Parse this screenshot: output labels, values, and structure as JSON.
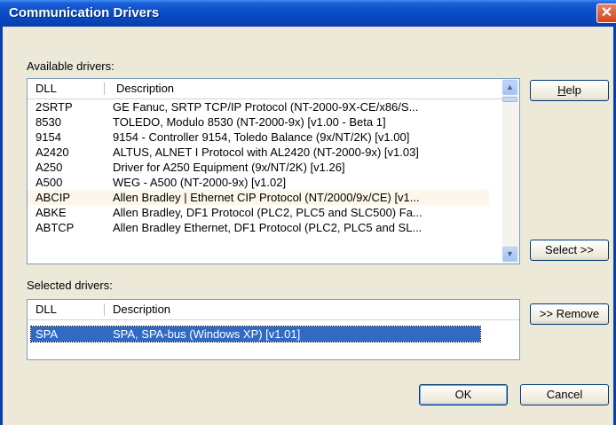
{
  "window": {
    "title": "Communication Drivers",
    "close_glyph": "✕"
  },
  "available": {
    "label": "Available drivers:",
    "col_dll": "DLL",
    "col_description": "Description",
    "rows": [
      {
        "dll": "2SRTP",
        "description": "GE Fanuc, SRTP TCP/IP Protocol (NT-2000-9X-CE/x86/S..."
      },
      {
        "dll": "8530",
        "description": "TOLEDO, Modulo 8530 (NT-2000-9x) [v1.00 - Beta 1]"
      },
      {
        "dll": "9154",
        "description": "9154 - Controller 9154, Toledo Balance (9x/NT/2K) [v1.00]"
      },
      {
        "dll": "A2420",
        "description": "ALTUS, ALNET I Protocol with AL2420 (NT-2000-9x) [v1.03]"
      },
      {
        "dll": "A250",
        "description": "Driver for A250 Equipment (9x/NT/2K) [v1.26]"
      },
      {
        "dll": "A500",
        "description": "WEG - A500 (NT-2000-9x) [v1.02]"
      },
      {
        "dll": "ABCIP",
        "description": "Allen Bradley | Ethernet CIP Protocol (NT/2000/9x/CE) [v1..."
      },
      {
        "dll": "ABKE",
        "description": "Allen Bradley, DF1 Protocol (PLC2, PLC5 and SLC500) Fa..."
      },
      {
        "dll": "ABTCP",
        "description": "Allen Bradley Ethernet, DF1 Protocol (PLC2, PLC5 and SL..."
      }
    ]
  },
  "selected": {
    "label": "Selected drivers:",
    "col_dll": "DLL",
    "col_description": "Description",
    "rows": [
      {
        "dll": "SPA",
        "description": "SPA, SPA-bus (Windows XP) [v1.01]"
      }
    ]
  },
  "buttons": {
    "help_underlined": "H",
    "help_rest": "elp",
    "select": "Select >>",
    "remove": ">> Remove",
    "ok": "OK",
    "cancel": "Cancel"
  },
  "icons": {
    "scroll_up": "▲",
    "scroll_down": "▼"
  },
  "colors": {
    "titlebar": "#0a4fc9",
    "selection": "#316ac5",
    "hover_row": "#fdf6ea"
  }
}
